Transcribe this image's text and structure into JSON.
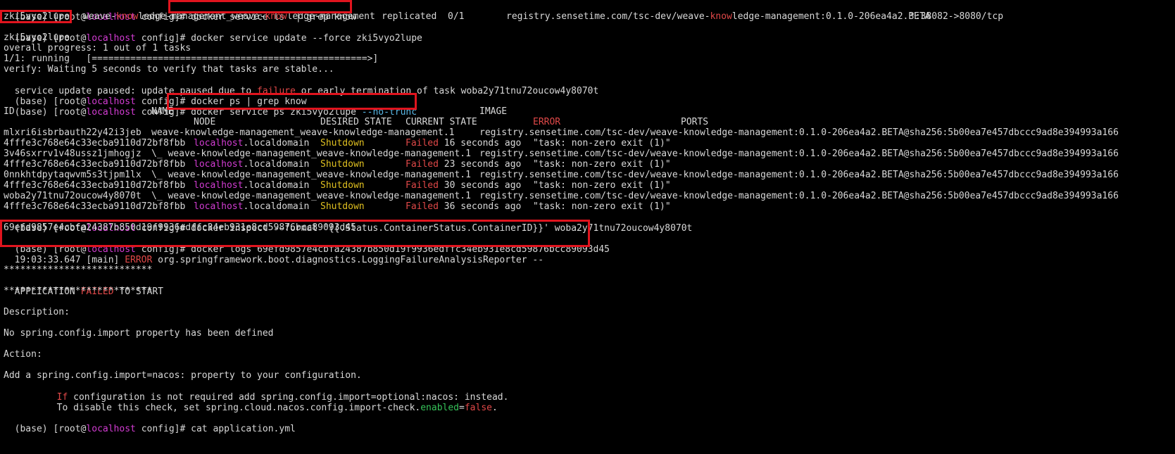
{
  "terminal": {
    "prompt": {
      "env": "(base) ",
      "user_prefix": "[root@",
      "host": "localhost",
      "dir_suffix": " config]# "
    },
    "ls_cmd": "docker service ls  | grep know",
    "ls_row": {
      "id": "zki5vyo2lupe",
      "name_parts": [
        "weave-",
        "know",
        "ledge-management_weave-",
        "know",
        "ledge-management"
      ],
      "mode": "replicated",
      "replicas": "0/1",
      "image_parts": [
        "registry.sensetime.com/tsc-dev/weave-",
        "know",
        "ledge-management:0.1.0-206ea4a2.BETA"
      ],
      "ports": "*:38082->8080/tcp"
    },
    "update_cmd": "docker service update --force zki5vyo2lupe",
    "update_output": [
      "zki5vyo2lupe",
      "overall progress: 1 out of 1 tasks",
      "1/1: running   [==================================================>]",
      "verify: Waiting 5 seconds to verify that tasks are stable..."
    ],
    "paused_line": {
      "before": "service update paused: update paused due to ",
      "word": "failure",
      "after": " or early termination of task woba2y71tnu72oucow4y8070t"
    },
    "ps_grep_cmd": "docker ps | grep know",
    "ps_cmd": "docker service ps zki5vyo2lupe ",
    "ps_flag": "--no-trunc",
    "ps_headers": {
      "id": "ID",
      "name": "NAME",
      "image": "IMAGE",
      "node": "NODE",
      "desired": "DESIRED STATE",
      "current": "CURRENT STATE",
      "error": "ERROR",
      "ports": "PORTS"
    },
    "ps_rows": [
      {
        "id": "mlxri6isbrbauth22y42i3jeb",
        "name": "weave-knowledge-management_weave-knowledge-management.1",
        "image": "registry.sensetime.com/tsc-dev/weave-knowledge-management:0.1.0-206ea4a2.BETA@sha256:5b00ea7e457dbccc9ad8e394993a166",
        "image_cont": "4fffe3c768e64c33ecba9110d72bf8fbb",
        "node": "localhost",
        "node_domain": ".localdomain",
        "desired": "Shutdown",
        "failed": "Failed",
        "ago": " 16 seconds ago",
        "error": "\"task: non-zero exit (1)\""
      },
      {
        "id": "3v46sxrrv1v48ussz1jmhogjz",
        "name": "\\_ weave-knowledge-management_weave-knowledge-management.1",
        "image": "registry.sensetime.com/tsc-dev/weave-knowledge-management:0.1.0-206ea4a2.BETA@sha256:5b00ea7e457dbccc9ad8e394993a166",
        "image_cont": "4fffe3c768e64c33ecba9110d72bf8fbb",
        "node": "localhost",
        "node_domain": ".localdomain",
        "desired": "Shutdown",
        "failed": "Failed",
        "ago": " 23 seconds ago",
        "error": "\"task: non-zero exit (1)\""
      },
      {
        "id": "0nnkhtdpytaqwvm5s3tjpm1lx",
        "name": "\\_ weave-knowledge-management_weave-knowledge-management.1",
        "image": "registry.sensetime.com/tsc-dev/weave-knowledge-management:0.1.0-206ea4a2.BETA@sha256:5b00ea7e457dbccc9ad8e394993a166",
        "image_cont": "4fffe3c768e64c33ecba9110d72bf8fbb",
        "node": "localhost",
        "node_domain": ".localdomain",
        "desired": "Shutdown",
        "failed": "Failed",
        "ago": " 30 seconds ago",
        "error": "\"task: non-zero exit (1)\""
      },
      {
        "id": "woba2y71tnu72oucow4y8070t",
        "name": "\\_ weave-knowledge-management_weave-knowledge-management.1",
        "image": "registry.sensetime.com/tsc-dev/weave-knowledge-management:0.1.0-206ea4a2.BETA@sha256:5b00ea7e457dbccc9ad8e394993a166",
        "image_cont": "4fffe3c768e64c33ecba9110d72bf8fbb",
        "node": "localhost",
        "node_domain": ".localdomain",
        "desired": "Shutdown",
        "failed": "Failed",
        "ago": " 36 seconds ago",
        "error": "\"task: non-zero exit (1)\""
      }
    ],
    "inspect_cmd": "docker inspect --format '{{.Status.ContainerStatus.ContainerID}}' woba2y71tnu72oucow4y8070t",
    "container_id": "69efd9857e4cbfa24387b850d19f9936edffc34eb931e8cd59876bcc89093d45",
    "logs_cmd": "docker logs 69efd9857e4cbfa24387b850d19f9936edffc34eb931e8cd59876bcc89093d45",
    "log_header": {
      "time": "19:03:33.647 [main] ",
      "level": "ERROR",
      "rest": " org.springframework.boot.diagnostics.LoggingFailureAnalysisReporter --"
    },
    "stars": "***************************",
    "app_failed": {
      "before": "APPLICATION ",
      "word": "FAILED",
      "after": " TO START"
    },
    "description_label": "Description:",
    "description_text": "No spring.config.import property has been defined",
    "action_label": "Action:",
    "action_text": "Add a spring.config.import=nacos: property to your configuration.",
    "action_if": {
      "keyword": "If",
      "rest": " configuration is not required add spring.config.import=optional:nacos: instead."
    },
    "action_disable": {
      "before": "To disable this check, set spring.cloud.nacos.config.import-check.",
      "key": "enabled",
      "eq": "=",
      "value": "false",
      "end": "."
    },
    "cat_cmd": "cat application.yml"
  }
}
